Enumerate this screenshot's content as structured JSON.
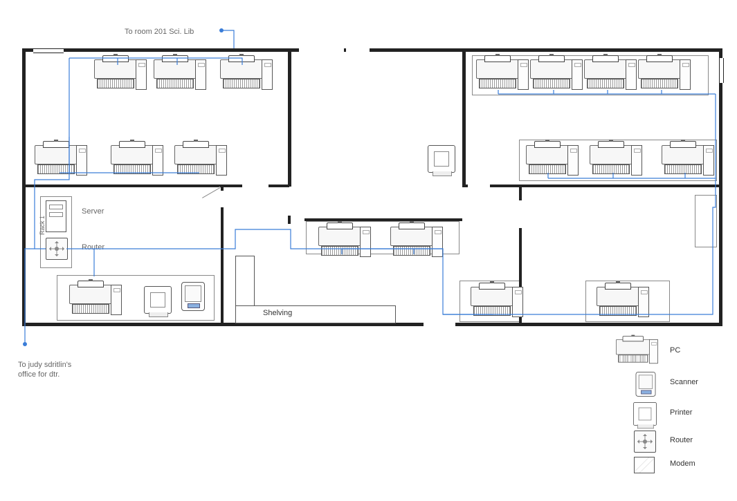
{
  "labels": {
    "to_room": "To room 201 Sci. Lib",
    "to_office_l1": "To judy sdritlin's",
    "to_office_l2": "office for dtr.",
    "server": "Server",
    "router": "Router",
    "rack": "Rack 1",
    "shelving": "Shelving"
  },
  "legend": {
    "pc": "PC",
    "scanner": "Scanner",
    "printer": "Printer",
    "router": "Router",
    "modem": "Modem"
  }
}
